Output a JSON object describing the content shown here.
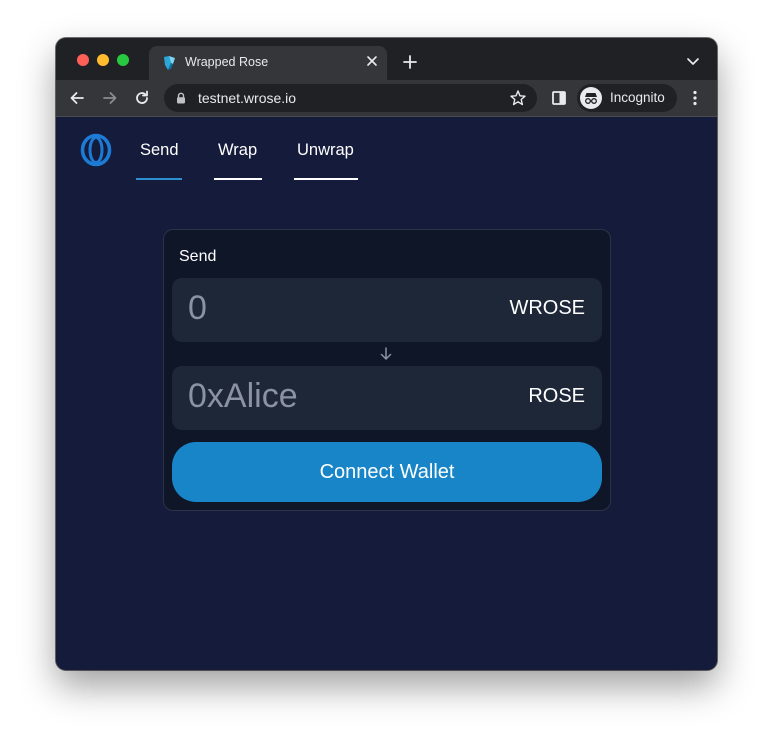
{
  "browser": {
    "tab": {
      "title": "Wrapped Rose"
    },
    "omnibox": {
      "url": "testnet.wrose.io"
    },
    "profile": {
      "label": "Incognito"
    }
  },
  "app": {
    "nav": [
      {
        "label": "Send",
        "active": true
      },
      {
        "label": "Wrap",
        "active": false
      },
      {
        "label": "Unwrap",
        "active": false
      }
    ],
    "card": {
      "label": "Send",
      "amount": {
        "value": "0",
        "unit": "WROSE"
      },
      "recipient": {
        "value": "0xAlice",
        "unit": "ROSE"
      },
      "connect_button": "Connect Wallet"
    }
  },
  "colors": {
    "page_bg": "#151b3b",
    "card_bg": "#0f1628",
    "field_bg": "#1e2738",
    "accent": "#1785c7",
    "nav_active_underline": "#2c8fd0"
  },
  "icons": {
    "app_logo": "oasis-logo-icon",
    "favicon": "wrose-favicon-icon",
    "back": "arrow-left-icon",
    "forward": "arrow-right-icon",
    "reload": "reload-icon",
    "lock": "lock-icon",
    "bookmark": "star-icon",
    "side_panel": "side-panel-icon",
    "incognito": "incognito-icon",
    "menu": "kebab-menu-icon",
    "direction": "arrow-down-icon"
  }
}
